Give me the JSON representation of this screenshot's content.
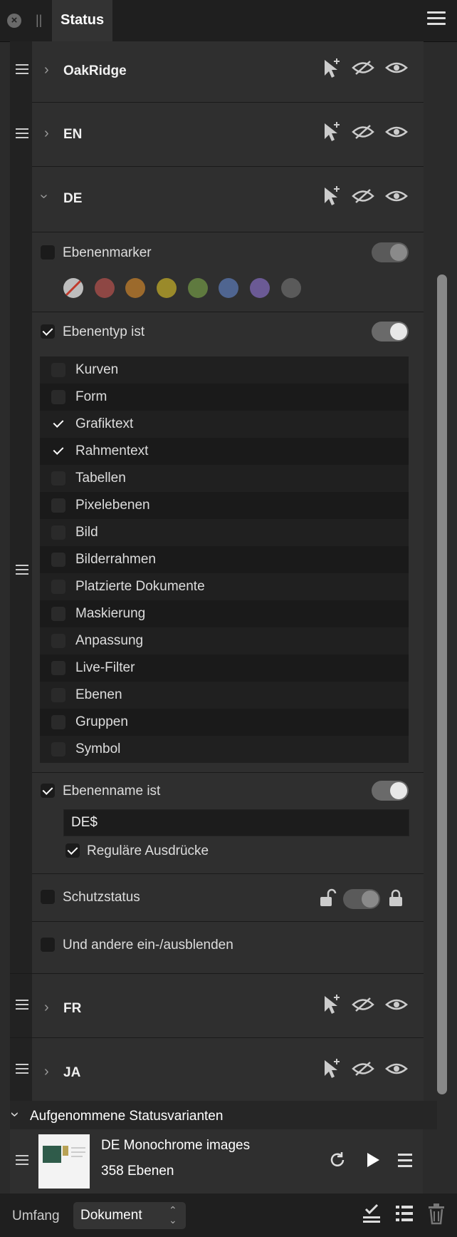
{
  "titlebar": {
    "tab_label": "Status"
  },
  "states": [
    {
      "name": "OakRidge",
      "expanded": false
    },
    {
      "name": "EN",
      "expanded": false
    },
    {
      "name": "DE",
      "expanded": true
    },
    {
      "name": "FR",
      "expanded": false
    },
    {
      "name": "JA",
      "expanded": false
    }
  ],
  "de": {
    "marker_label": "Ebenenmarker",
    "marker_colors": [
      "none",
      "#9a4a46",
      "#a06a2a",
      "#9a8a2a",
      "#5f7a3f",
      "#4f6590",
      "#6b5a95",
      "#5a5a5a"
    ],
    "type_label": "Ebenentyp ist",
    "types": [
      {
        "label": "Kurven",
        "checked": false
      },
      {
        "label": "Form",
        "checked": false
      },
      {
        "label": "Grafiktext",
        "checked": true
      },
      {
        "label": "Rahmentext",
        "checked": true
      },
      {
        "label": "Tabellen",
        "checked": false
      },
      {
        "label": "Pixelebenen",
        "checked": false
      },
      {
        "label": "Bild",
        "checked": false
      },
      {
        "label": "Bilderrahmen",
        "checked": false
      },
      {
        "label": "Platzierte Dokumente",
        "checked": false
      },
      {
        "label": "Maskierung",
        "checked": false
      },
      {
        "label": "Anpassung",
        "checked": false
      },
      {
        "label": "Live-Filter",
        "checked": false
      },
      {
        "label": "Ebenen",
        "checked": false
      },
      {
        "label": "Gruppen",
        "checked": false
      },
      {
        "label": "Symbol",
        "checked": false
      }
    ],
    "name_label": "Ebenenname ist",
    "name_value": "DE$",
    "regex_label": "Reguläre Ausdrücke",
    "protect_label": "Schutzstatus",
    "others_label": "Und andere ein-/ausblenden"
  },
  "recorded": {
    "header": "Aufgenommene Statusvarianten",
    "item_title": "DE Monochrome images",
    "item_count": "358 Ebenen"
  },
  "footer": {
    "scope_label": "Umfang",
    "scope_value": "Dokument"
  }
}
